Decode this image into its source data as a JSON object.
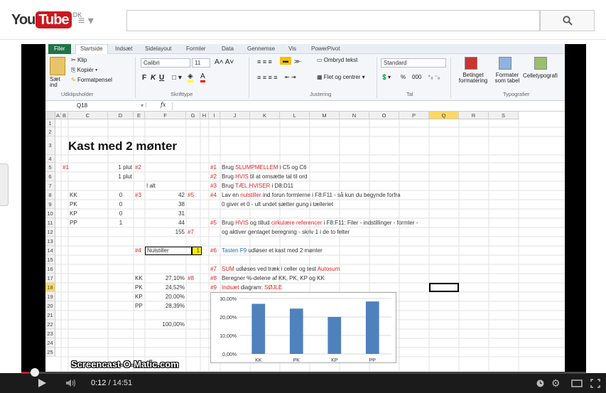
{
  "youtube": {
    "logo_you": "You",
    "logo_tube": "Tube",
    "region": "DK",
    "menu_icon": "hamburger-icon",
    "search_placeholder": "",
    "search_icon": "search-icon"
  },
  "excel": {
    "tabs": [
      "Filer",
      "Startside",
      "Indsæt",
      "Sidelayout",
      "Formler",
      "Data",
      "Gennemse",
      "Vis",
      "PowerPivot"
    ],
    "ribbon": {
      "paste": "Sæt ind",
      "cut": "Klip",
      "copy": "Kopiér",
      "format_painter": "Formatpensel",
      "group_clipboard": "Udklipsholder",
      "font_name": "Calibri",
      "font_size": "11",
      "group_font": "Skrifttype",
      "wrap": "Ombryd tekst",
      "merge": "Flet og centrer",
      "group_align": "Justering",
      "number_format": "Standard",
      "group_number": "Tal",
      "pct": "%",
      "thousand": "000",
      "cond_format": "Betinget formatering",
      "format_table": "Formater som tabel",
      "cell_styles": "Celletypografi",
      "group_styles": "Typografier"
    },
    "namebox": "Q18",
    "fx": "fx",
    "columns": [
      "A",
      "B",
      "C",
      "D",
      "E",
      "F",
      "G",
      "H",
      "I",
      "J",
      "K",
      "L",
      "M",
      "N",
      "O",
      "P",
      "Q",
      "R",
      "S"
    ],
    "rows": [
      "1",
      "2",
      "3",
      "4",
      "5",
      "6",
      "7",
      "8",
      "9",
      "10",
      "11",
      "12",
      "13",
      "14",
      "15",
      "16",
      "17",
      "18",
      "19",
      "20",
      "21",
      "22",
      "23",
      "24",
      "25"
    ],
    "title": "Kast med 2 mønter",
    "cells": {
      "b5": "#1",
      "d5": "1 plut",
      "e5": "#2",
      "d6": "1 plut",
      "f7": "I alt",
      "c8": "KK",
      "d8": "0",
      "e8": "#3",
      "f8": "42",
      "g8": "#5",
      "c9": "PK",
      "d9": "0",
      "f9": "38",
      "c10": "KP",
      "d10": "0",
      "f10": "31",
      "c11": "PP",
      "d11": "1",
      "f11": "44",
      "f12": "155",
      "g12": "#7",
      "e14": "#4",
      "f14": "Nulstiller",
      "g14": "1",
      "e17": "KK",
      "f17": "27,10%",
      "g17": "#8",
      "e18": "PK",
      "f18": "24,52%",
      "e19": "KP",
      "f19": "20,00%",
      "e20": "PP",
      "f20": "28,39%",
      "f22": "100,00%"
    },
    "notes": [
      {
        "num": "#1",
        "pre": "Brug ",
        "key": "SLUMPMELLEM",
        "post": " i C5 og C6"
      },
      {
        "num": "#2",
        "pre": "Brug ",
        "key": "HVIS",
        "post": " til at omsætte tal til ord"
      },
      {
        "num": "#3",
        "pre": "Brug ",
        "key": "TÆL.HVISER",
        "post": " i D8:D11"
      },
      {
        "num": "#4",
        "pre": "Lav en ",
        "key": "nulstiller",
        "post": " ind forun formlerne i F8:F11 - så kun du begynde forfra"
      },
      {
        "num": "",
        "pre": "0 giver et 0 - ult undet sætter gung i tælleriet",
        "key": "",
        "post": ""
      },
      {
        "num": "#5",
        "pre": "Brug ",
        "key": "HVIS",
        "mid": " og tillud ",
        "key2": "cirkulære referencer",
        "post": " i F8:F11: Filer - indstillinger - formler -"
      },
      {
        "num": "",
        "pre": "og aktiver gentaget beregning - skriv 1 i de to felter",
        "key": "",
        "post": ""
      },
      {
        "num": "#6",
        "pre": "",
        "key": "Tasten F9",
        "post": " udløser et kast med 2 mønter"
      },
      {
        "num": "#7",
        "pre": "",
        "key": "SUM",
        "post": " udløses ved træk i celler og test ",
        "key3": "Autosum"
      },
      {
        "num": "#8",
        "pre": "Beregner %-delene af KK, PK, KP og KK",
        "key": "",
        "post": ""
      },
      {
        "num": "#9",
        "pre": "",
        "key": "Indsæt",
        "post": " diagram: ",
        "key3": "SØJLE"
      }
    ]
  },
  "chart_data": {
    "type": "bar",
    "categories": [
      "KK",
      "PK",
      "KP",
      "PP"
    ],
    "values": [
      27.1,
      24.52,
      20.0,
      28.39
    ],
    "ylim": [
      0,
      30
    ],
    "yticks": [
      "0,00%",
      "10,00%",
      "20,00%",
      "30,00%"
    ],
    "title": "",
    "xlabel": "",
    "ylabel": "",
    "color": "#4f81bd",
    "grid": true
  },
  "player": {
    "watermark": "Screencast-O-Matic.com",
    "current": "0:12",
    "duration": "14:51",
    "progress": 0.013,
    "icons": [
      "play-icon",
      "volume-icon",
      "clock-icon",
      "gear-icon",
      "theater-icon",
      "fullscreen-icon"
    ]
  }
}
